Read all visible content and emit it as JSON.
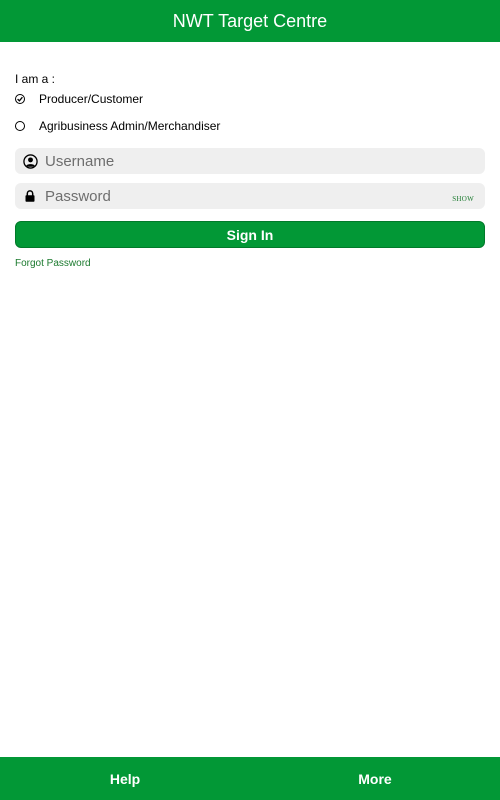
{
  "header": {
    "title": "NWT Target Centre"
  },
  "form": {
    "role_label": "I am a :",
    "roles": [
      {
        "label": "Producer/Customer",
        "selected": true
      },
      {
        "label": "Agribusiness Admin/Merchandiser",
        "selected": false
      }
    ],
    "username": {
      "placeholder": "Username",
      "value": "",
      "icon": "user-circle-icon"
    },
    "password": {
      "placeholder": "Password",
      "value": "",
      "icon": "lock-icon",
      "show_label": "SHOW"
    },
    "signin_label": "Sign In",
    "forgot_label": "Forgot Password"
  },
  "footer": {
    "help_label": "Help",
    "more_label": "More"
  },
  "colors": {
    "brand_green": "#029836",
    "link_green": "#1b7a2e",
    "input_bg": "#efefef"
  }
}
